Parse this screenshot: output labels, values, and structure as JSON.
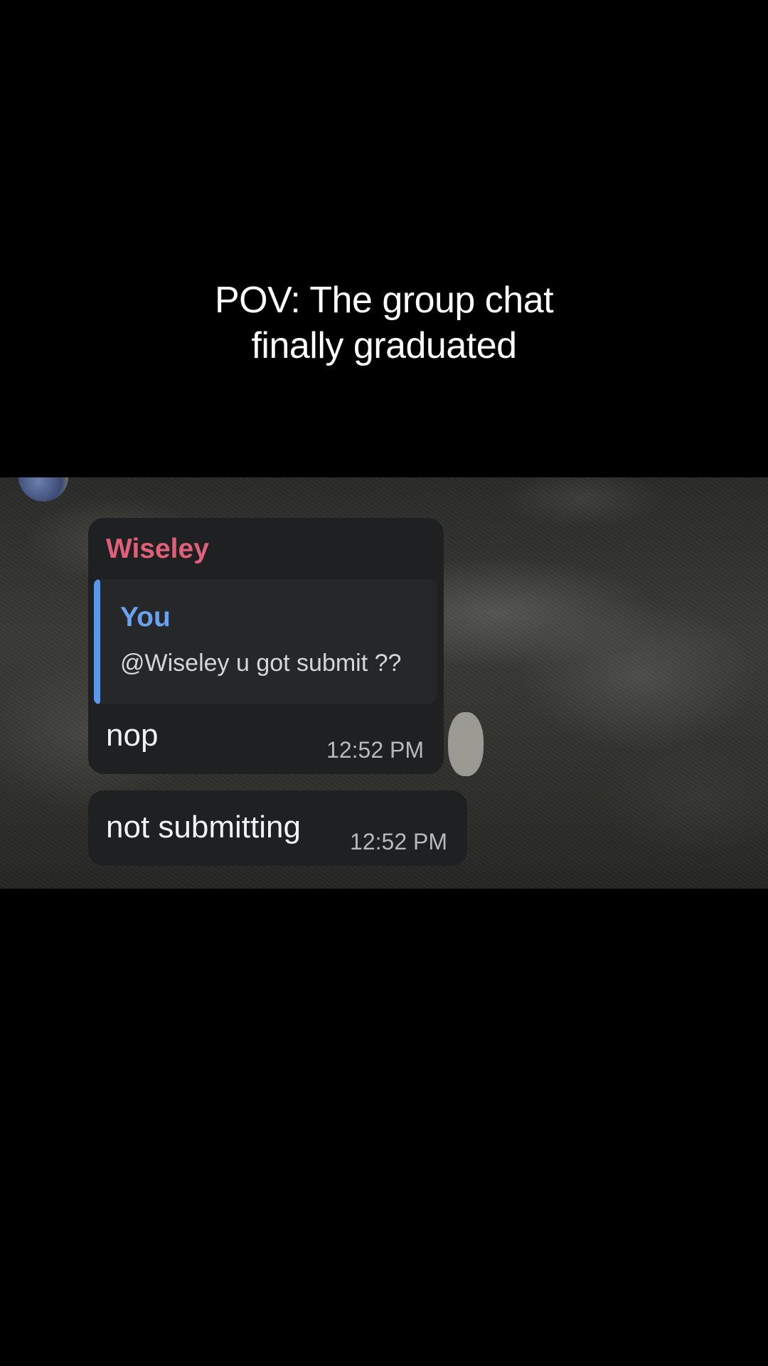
{
  "caption": {
    "line1": "POV: The group chat",
    "line2": "finally graduated"
  },
  "chat": {
    "sender_name": "Wiseley",
    "sender_name_color": "#e0607a",
    "reply": {
      "author": "You",
      "author_color": "#6aa2f0",
      "text": "@Wiseley u got submit ??"
    },
    "messages": [
      {
        "text": "nop",
        "time": "12:52 PM"
      },
      {
        "text": "not submitting",
        "time": "12:52 PM"
      }
    ]
  },
  "colors": {
    "background": "#000000",
    "bubble": "#1f2021",
    "reply_accent": "#5b96e8"
  }
}
